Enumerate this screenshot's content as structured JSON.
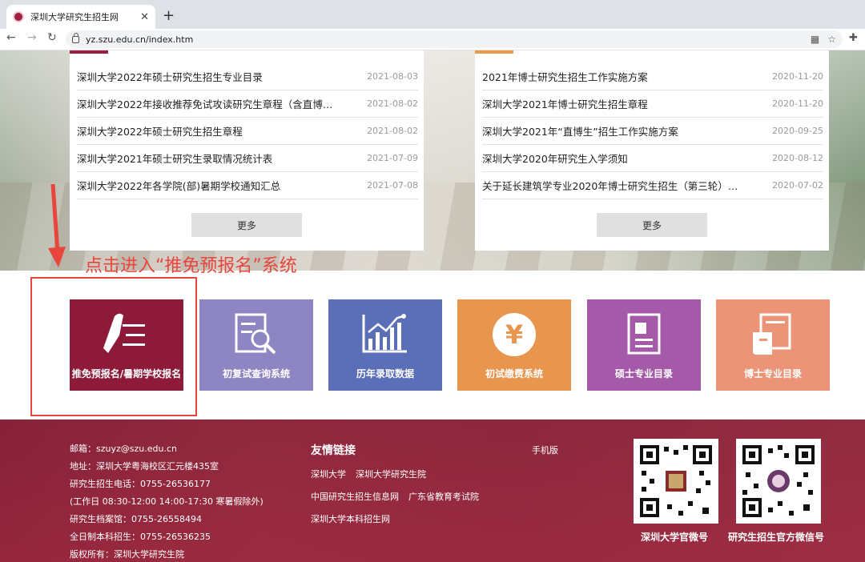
{
  "browser": {
    "tab_title": "深圳大学研究生招生网",
    "url": "yz.szu.edu.cn/index.htm"
  },
  "left_news": {
    "items": [
      {
        "title": "深圳大学2022年硕士研究生招生专业目录",
        "date": "2021-08-03"
      },
      {
        "title": "深圳大学2022年接收推荐免试攻读研究生章程（含直博…",
        "date": "2021-08-02"
      },
      {
        "title": "深圳大学2022年硕士研究生招生章程",
        "date": "2021-08-02"
      },
      {
        "title": "深圳大学2021年硕士研究生录取情况统计表",
        "date": "2021-07-09"
      },
      {
        "title": "深圳大学2022年各学院(部)暑期学校通知汇总",
        "date": "2021-07-08"
      }
    ],
    "more_label": "更多",
    "accent_color": "#9d1f3f"
  },
  "right_news": {
    "items": [
      {
        "title": "2021年博士研究生招生工作实施方案",
        "date": "2020-11-20"
      },
      {
        "title": "深圳大学2021年博士研究生招生章程",
        "date": "2020-11-20"
      },
      {
        "title": "深圳大学2021年“直博生”招生工作实施方案",
        "date": "2020-09-25"
      },
      {
        "title": "深圳大学2020年研究生入学须知",
        "date": "2020-08-12"
      },
      {
        "title": "关于延长建筑学专业2020年博士研究生招生（第三轮）…",
        "date": "2020-07-02"
      }
    ],
    "more_label": "更多",
    "accent_color": "#e89a4a"
  },
  "annotation": {
    "text": "点击进入“推免预报名”系统",
    "color": "#e8453c"
  },
  "tiles": [
    {
      "label": "推免预报名/暑期学校报名",
      "icon": "pen-list-icon",
      "color": "#8e1a3a"
    },
    {
      "label": "初复试查询系统",
      "icon": "document-search-icon",
      "color": "#8d86c2"
    },
    {
      "label": "历年录取数据",
      "icon": "bar-chart-icon",
      "color": "#5a6fb7"
    },
    {
      "label": "初试缴费系统",
      "icon": "yuan-coin-icon",
      "color": "#e8954e"
    },
    {
      "label": "硕士专业目录",
      "icon": "profile-doc-icon",
      "color": "#a45aa8"
    },
    {
      "label": "博士专业目录",
      "icon": "book-icon",
      "color": "#eb9477"
    }
  ],
  "footer": {
    "contact": [
      "邮箱：szuyz@szu.edu.cn",
      "地址：深圳大学粤海校区汇元楼435室",
      "研究生招生电话：0755-26536177",
      "(工作日 08:30-12:00 14:00-17:30 寒暑假除外)",
      "研究生档案馆：0755-26558494",
      "全日制本科招生：0755-26536235",
      "版权所有：深圳大学研究生院"
    ],
    "links_title": "友情链接",
    "links": [
      "深圳大学",
      "深圳大学研究生院",
      "中国研究生招生信息网",
      "广东省教育考试院",
      "深圳大学本科招生网"
    ],
    "mobile_label": "手机版",
    "qr_codes": [
      {
        "caption": "深圳大学官微号"
      },
      {
        "caption": "研究生招生官方微信号"
      }
    ]
  }
}
